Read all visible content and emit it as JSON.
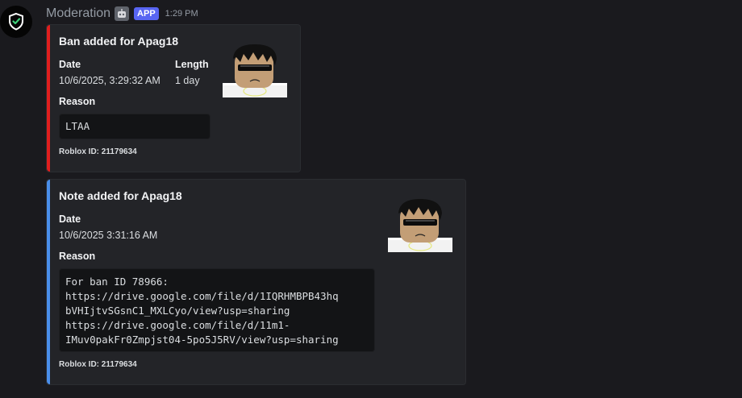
{
  "author": {
    "name": "Moderation",
    "tag": "APP",
    "timestamp": "1:29 PM",
    "avatar_icon": "shield-check-icon"
  },
  "embeds": [
    {
      "accent": "#e01e1e",
      "title": "Ban added for Apag18",
      "fields": [
        {
          "name": "Date",
          "value": "10/6/2025, 3:29:32 AM"
        },
        {
          "name": "Length",
          "value": "1 day"
        },
        {
          "name": "Reason",
          "value": "LTAA"
        }
      ],
      "footer": "Roblox ID: 21179634",
      "thumbnail": "roblox-avatar-thumbnail"
    },
    {
      "accent": "#4a8eea",
      "title": "Note added for Apag18",
      "fields": [
        {
          "name": "Date",
          "value": "10/6/2025 3:31:16 AM"
        },
        {
          "name": "Reason",
          "value": "For ban ID 78966:\nhttps://drive.google.com/file/d/1IQRHMBPB43hq\nbVHIjtvSGsnC1_MXLCyo/view?usp=sharing\nhttps://drive.google.com/file/d/11m1-\nIMuv0pakFr0Zmpjst04-5po5J5RV/view?usp=sharing"
        }
      ],
      "footer": "Roblox ID: 21179634",
      "thumbnail": "roblox-avatar-thumbnail"
    }
  ]
}
